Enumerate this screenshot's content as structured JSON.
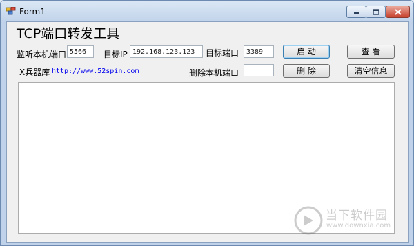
{
  "window": {
    "title": "Form1"
  },
  "form": {
    "heading": "TCP端口转发工具",
    "listen_port_label": "监听本机端口",
    "listen_port_value": "5566",
    "target_ip_label": "目标IP",
    "target_ip_value": "192.168.123.123",
    "target_port_label": "目标端口",
    "target_port_value": "3389",
    "start_button": "启 动",
    "view_button": "查 看",
    "arsenal_label": "X兵器库",
    "arsenal_link": "http://www.52spin.com",
    "delete_port_label": "删除本机端口",
    "delete_port_value": "",
    "delete_button": "删 除",
    "clear_button": "清空信息"
  },
  "watermark": {
    "line1": "当下软件园",
    "line2": "www.downxia.com"
  },
  "colors": {
    "titlebar": "#c6d7ec",
    "close_button": "#c8412c",
    "client": "#f0f0f0",
    "link": "#0000ee"
  },
  "icons": [
    "app-icon",
    "minimize-icon",
    "maximize-icon",
    "close-icon"
  ]
}
